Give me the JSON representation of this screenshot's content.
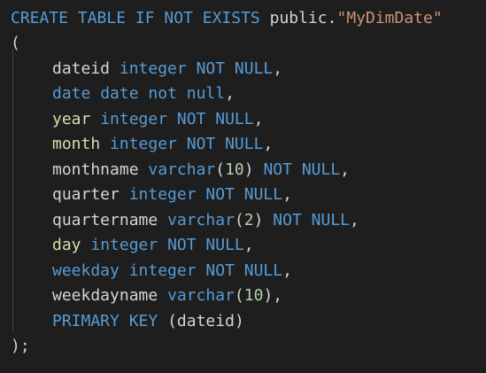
{
  "code": {
    "line1": {
      "kw": "CREATE TABLE IF NOT EXISTS",
      "sp": " ",
      "schema": "public",
      "dot": ".",
      "table": "\"MyDimDate\""
    },
    "open_paren": "(",
    "columns": [
      {
        "name": "dateid",
        "type": "integer",
        "constraint": "NOT NULL",
        "punct": ","
      },
      {
        "name": "date",
        "type": "date",
        "constraint": "not null",
        "punct": ","
      },
      {
        "name": "year",
        "type": "integer",
        "constraint": "NOT NULL",
        "punct": ","
      },
      {
        "name": "month",
        "type": "integer",
        "constraint": "NOT NULL",
        "punct": ","
      },
      {
        "name": "monthname",
        "type": "varchar",
        "size": "10",
        "constraint": "NOT NULL",
        "punct": ","
      },
      {
        "name": "quarter",
        "type": "integer",
        "constraint": "NOT NULL",
        "punct": ","
      },
      {
        "name": "quartername",
        "type": "varchar",
        "size": "2",
        "constraint": "NOT NULL",
        "punct": ","
      },
      {
        "name": "day",
        "type": "integer",
        "constraint": "NOT NULL",
        "punct": ","
      },
      {
        "name": "weekday",
        "type": "integer",
        "constraint": "NOT NULL",
        "punct": ","
      },
      {
        "name": "weekdayname",
        "type": "varchar",
        "size": "10",
        "constraint": "",
        "punct": ","
      }
    ],
    "primary_key": {
      "kw": "PRIMARY KEY",
      "column": "dateid"
    },
    "close": ");"
  },
  "colors": {
    "background": "#1e1e1e",
    "keyword": "#569cd6",
    "function": "#dcdcaa",
    "string": "#ce9178",
    "number": "#b5cea8",
    "identifier": "#9cdcfe",
    "text": "#d4d4d4"
  }
}
